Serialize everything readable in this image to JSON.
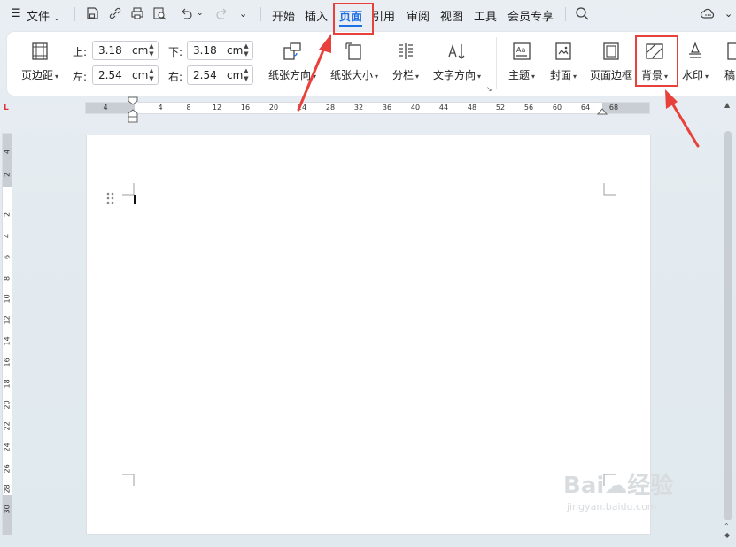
{
  "menubar": {
    "file_label": "文件",
    "tabs": [
      "开始",
      "插入",
      "页面",
      "引用",
      "审阅",
      "视图",
      "工具",
      "会员专享"
    ],
    "active_tab": "页面"
  },
  "ribbon": {
    "margins_label": "页边距",
    "top_label": "上:",
    "top_value": "3.18",
    "bottom_label": "下:",
    "bottom_value": "3.18",
    "left_label": "左:",
    "left_value": "2.54",
    "right_label": "右:",
    "right_value": "2.54",
    "unit": "cm",
    "orientation_label": "纸张方向",
    "size_label": "纸张大小",
    "columns_label": "分栏",
    "text_direction_label": "文字方向",
    "theme_label": "主题",
    "cover_label": "封面",
    "page_border_label": "页面边框",
    "background_label": "背景",
    "watermark_label": "水印",
    "partial_label": "稿"
  },
  "ruler": {
    "h_ticks": [
      "4",
      "4",
      "8",
      "12",
      "16",
      "20",
      "24",
      "28",
      "32",
      "36",
      "40",
      "44",
      "48",
      "52",
      "56",
      "60",
      "64",
      "68"
    ],
    "v_ticks": [
      "4",
      "2",
      "2",
      "4",
      "6",
      "8",
      "10",
      "12",
      "14",
      "16",
      "18",
      "20",
      "22",
      "24",
      "26",
      "28",
      "30"
    ]
  },
  "colors": {
    "accent": "#1f6fe5",
    "highlight": "#e8413b"
  },
  "watermark": {
    "brand": "Bai",
    "brand_cn": "经验",
    "url": "jingyan.baidu.com"
  }
}
